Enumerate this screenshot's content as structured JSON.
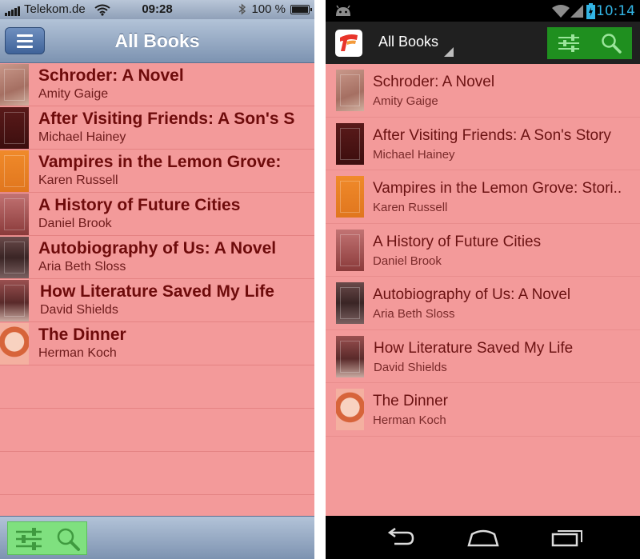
{
  "ios": {
    "status": {
      "carrier": "Telekom.de",
      "time": "09:28",
      "battery": "100 %",
      "battery_level": 1.0
    },
    "nav": {
      "title": "All Books"
    },
    "books": [
      {
        "title": "Schroder: A Novel",
        "author": "Amity Gaige"
      },
      {
        "title": "After Visiting Friends: A Son's S",
        "author": "Michael Hainey"
      },
      {
        "title": "Vampires in the Lemon Grove:",
        "author": "Karen Russell"
      },
      {
        "title": "A History of Future Cities",
        "author": "Daniel Brook"
      },
      {
        "title": "Autobiography of Us: A Novel",
        "author": "Aria Beth Sloss"
      },
      {
        "title": "How Literature Saved My Life",
        "author": "David Shields"
      },
      {
        "title": "The Dinner",
        "author": "Herman Koch"
      }
    ],
    "toolbar": {
      "icons": [
        "sliders-icon",
        "search-icon"
      ]
    }
  },
  "android": {
    "status": {
      "time": "10:14",
      "icons": [
        "android-icon",
        "wifi-icon",
        "signal-icon",
        "battery-icon"
      ]
    },
    "actionbar": {
      "title": "All Books"
    },
    "books": [
      {
        "title": "Schroder: A Novel",
        "author": "Amity Gaige"
      },
      {
        "title": "After Visiting Friends: A Son's Story",
        "author": "Michael Hainey"
      },
      {
        "title": "Vampires in the Lemon Grove: Stori..",
        "author": "Karen Russell"
      },
      {
        "title": "A History of Future Cities",
        "author": "Daniel Brook"
      },
      {
        "title": "Autobiography of Us: A Novel",
        "author": "Aria Beth Sloss"
      },
      {
        "title": "How Literature Saved My Life",
        "author": "David Shields"
      },
      {
        "title": "The Dinner",
        "author": "Herman Koch"
      }
    ],
    "nav": {
      "icons": [
        "back-icon",
        "home-icon",
        "recent-apps-icon"
      ]
    }
  },
  "colors": {
    "list_background": "#f39a9a",
    "title_text": "#6e0b0b",
    "action_green": "#1f8f1f",
    "android_time": "#33b5e5"
  }
}
